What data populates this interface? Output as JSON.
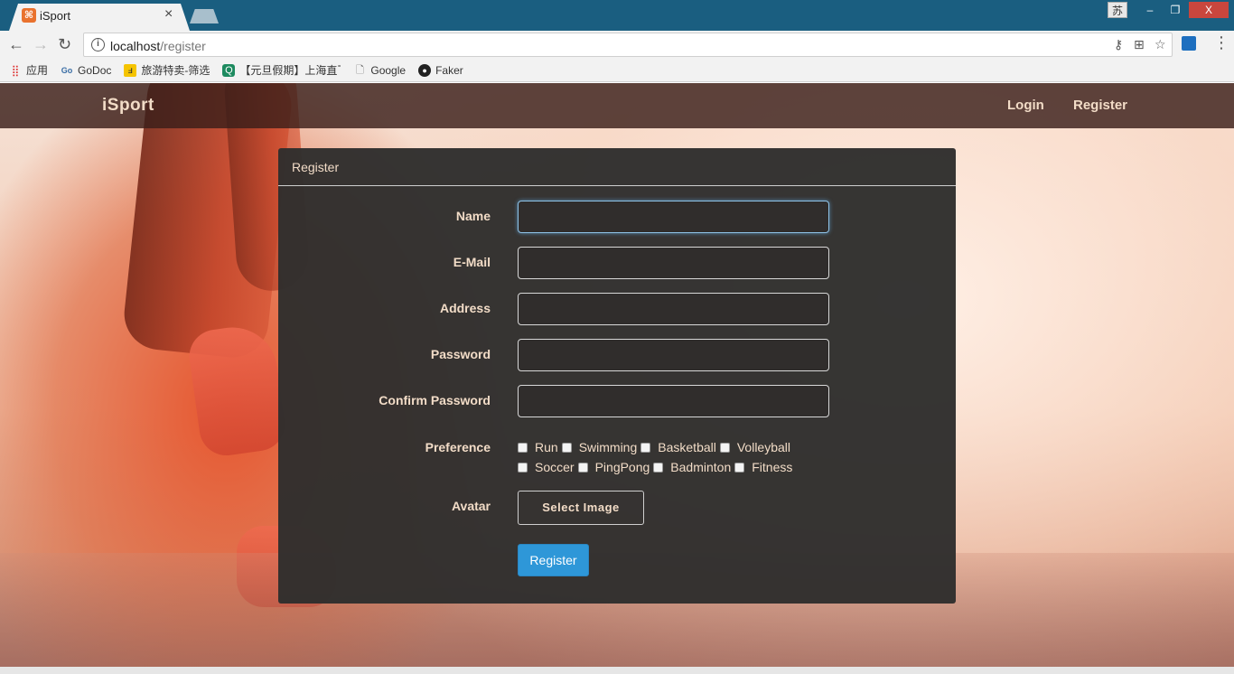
{
  "browser": {
    "tab_title": "iSport",
    "tab_favicon": "xampp-icon",
    "close_glyph": "×",
    "window": {
      "ime": "苏",
      "minimize": "–",
      "maximize": "❐",
      "close": "X"
    },
    "url_host": "localhost",
    "url_path": "/register",
    "bookmarks": [
      {
        "label": "应用",
        "icon": "apps-grid-icon"
      },
      {
        "label": "GoDoc",
        "icon": "godoc-icon"
      },
      {
        "label": "旅游特卖-筛选",
        "icon": "travel-icon"
      },
      {
        "label": "【元旦假期】上海直飞",
        "icon": "qunar-icon"
      },
      {
        "label": "Google",
        "icon": "page-icon"
      },
      {
        "label": "Faker",
        "icon": "github-icon"
      }
    ]
  },
  "navbar": {
    "brand": "iSport",
    "links": {
      "login": "Login",
      "register": "Register"
    }
  },
  "form": {
    "heading": "Register",
    "fields": {
      "name": {
        "label": "Name",
        "value": ""
      },
      "email": {
        "label": "E-Mail",
        "value": ""
      },
      "address": {
        "label": "Address",
        "value": ""
      },
      "password": {
        "label": "Password",
        "value": ""
      },
      "confirm": {
        "label": "Confirm Password",
        "value": ""
      }
    },
    "preference_label": "Preference",
    "preferences_row1": [
      "Run",
      "Swimming",
      "Basketball",
      "Volleyball"
    ],
    "preferences_row2": [
      "Soccer",
      "PingPong",
      "Badminton",
      "Fitness"
    ],
    "avatar_label": "Avatar",
    "select_image": "Select Image",
    "submit": "Register"
  },
  "colors": {
    "accent": "#2e97d8",
    "panel_text": "#f2dcc7",
    "tabbar": "#1a5e80"
  }
}
